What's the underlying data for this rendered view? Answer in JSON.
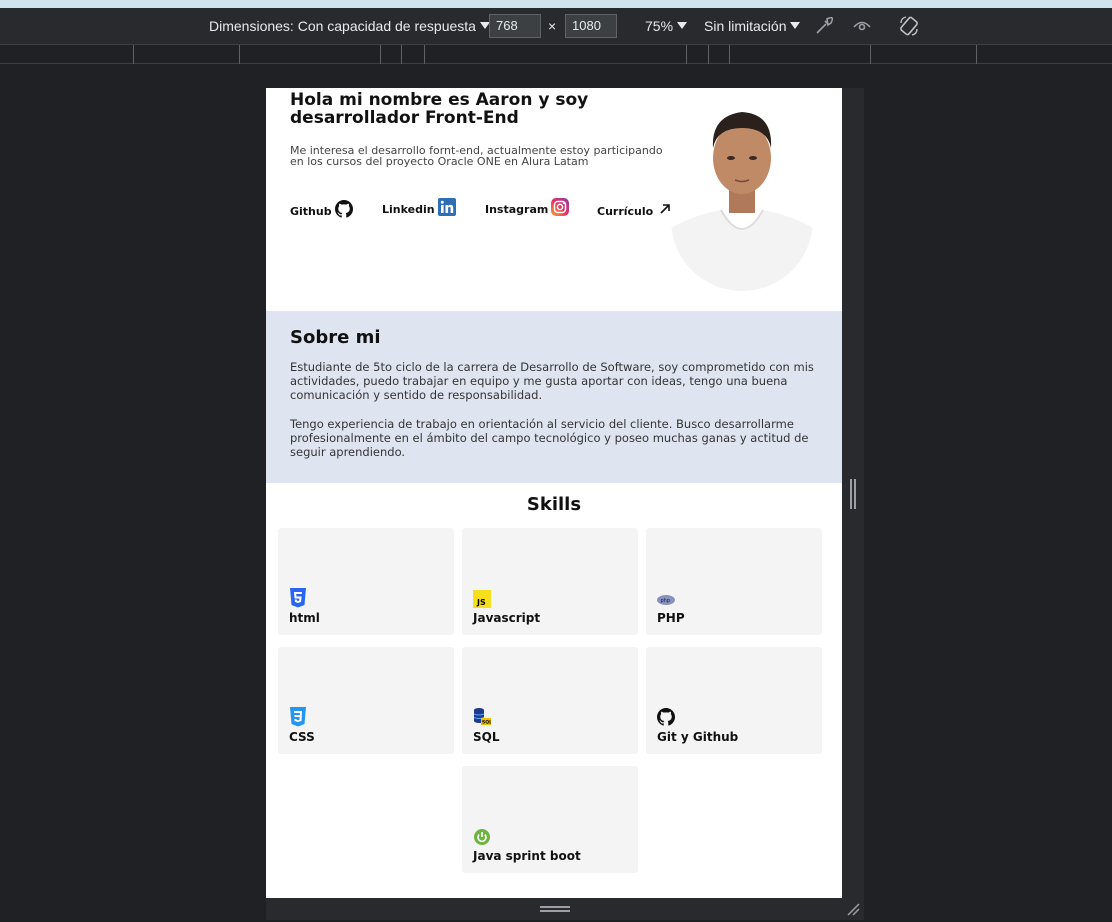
{
  "devtools": {
    "dimensions_label": "Dimensiones: Con capacidad de respuesta",
    "width_value": "768",
    "height_value": "1080",
    "times": "×",
    "zoom": "75%",
    "throttling": "Sin limitación"
  },
  "hero": {
    "title": "Hola mi nombre es Aaron y soy desarrollador Front-End",
    "intro": "Me interesa el desarrollo fornt-end, actualmente estoy participando en los cursos del proyecto Oracle ONE en Alura Latam",
    "links": {
      "github": "Github",
      "linkedin": "Linkedin",
      "instagram": "Instagram",
      "cv": "Currículo"
    }
  },
  "about": {
    "title": "Sobre mi",
    "p1": "Estudiante de 5to ciclo de la carrera de Desarrollo de Software, soy comprometido con mis actividades, puedo trabajar en equipo y me gusta aportar con ideas, tengo una buena comunicación y sentido de responsabilidad.",
    "p2": "Tengo experiencia de trabajo en orientación al servicio del cliente. Busco desarrollarme profesionalmente en el ámbito del campo tecnológico y poseo muchas ganas y actitud de seguir aprendiendo."
  },
  "skills": {
    "title": "Skills",
    "items": [
      {
        "label": "html",
        "icon": "html5-icon"
      },
      {
        "label": "Javascript",
        "icon": "javascript-icon"
      },
      {
        "label": "PHP",
        "icon": "php-icon"
      },
      {
        "label": "CSS",
        "icon": "css3-icon"
      },
      {
        "label": "SQL",
        "icon": "database-icon"
      },
      {
        "label": "Git y Github",
        "icon": "github-icon"
      },
      {
        "label": "Java sprint boot",
        "icon": "spring-icon"
      }
    ]
  }
}
